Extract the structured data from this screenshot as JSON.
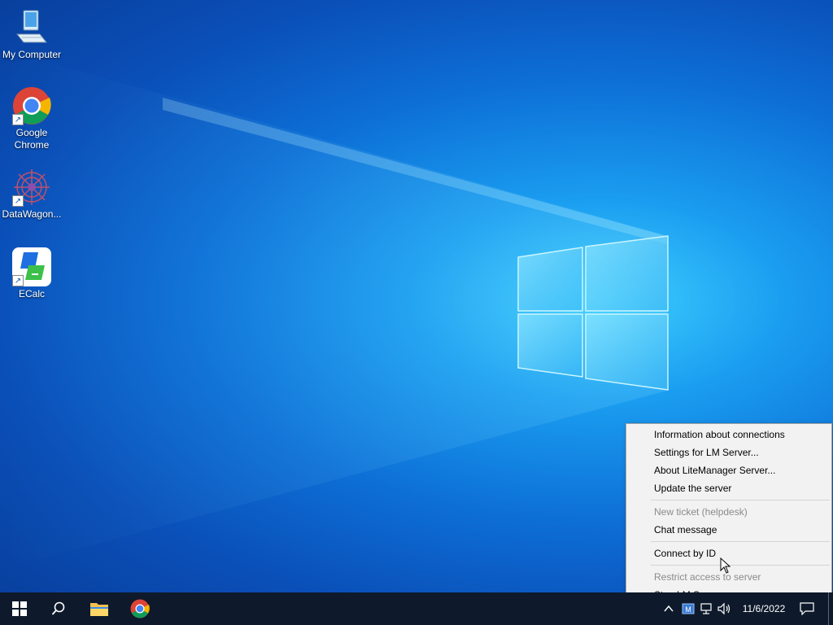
{
  "desktop": {
    "icons": [
      {
        "label": "My Computer",
        "icon": "computer-icon"
      },
      {
        "label": "Google\nChrome",
        "icon": "chrome-icon"
      },
      {
        "label": "DataWagon...",
        "icon": "datawagon-icon"
      },
      {
        "label": "ECalc",
        "icon": "ecalc-icon"
      }
    ]
  },
  "context_menu": {
    "items": [
      {
        "label": "Information about connections",
        "enabled": true
      },
      {
        "label": "Settings for LM Server...",
        "enabled": true
      },
      {
        "label": "About LiteManager Server...",
        "enabled": true
      },
      {
        "label": "Update the server",
        "enabled": true
      },
      {
        "label": "New ticket (helpdesk)",
        "enabled": false
      },
      {
        "label": "Chat message",
        "enabled": true
      },
      {
        "label": "Connect by ID",
        "enabled": true
      },
      {
        "label": "Restrict access to server",
        "enabled": false
      },
      {
        "label": "Stop LM Server",
        "enabled": true
      }
    ]
  },
  "taskbar": {
    "pinned": [
      "windows-start-icon",
      "search-icon",
      "file-explorer-icon",
      "chrome-icon"
    ],
    "tray_icons": [
      "chevron-up-icon",
      "litemanager-icon",
      "network-icon",
      "volume-icon"
    ],
    "clock": "11/6/2022"
  },
  "colors": {
    "taskbar": "#0e1a2b",
    "menu_bg": "#f2f2f2",
    "disabled_text": "#8a8a8a"
  }
}
